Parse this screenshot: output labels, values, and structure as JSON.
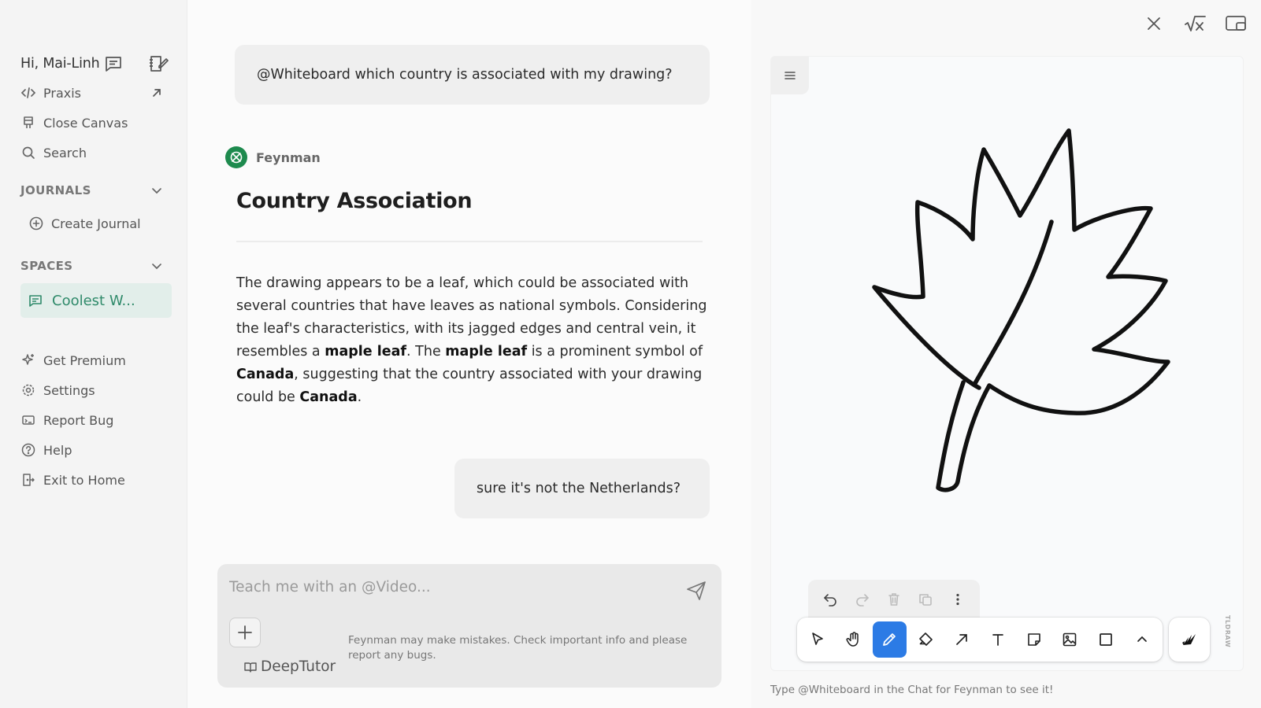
{
  "sidebar": {
    "greeting": "Hi, Mai-Linh",
    "top_items": [
      {
        "label": "Praxis",
        "icon": "code-icon"
      },
      {
        "label": "Close Canvas",
        "icon": "canvas-icon"
      },
      {
        "label": "Search",
        "icon": "search-icon"
      }
    ],
    "journals": {
      "heading": "JOURNALS",
      "create_label": "Create Journal"
    },
    "spaces": {
      "heading": "SPACES",
      "active_space": "Coolest W..."
    },
    "bottom_items": [
      {
        "label": "Get Premium",
        "icon": "sparkle-icon"
      },
      {
        "label": "Settings",
        "icon": "gear-icon"
      },
      {
        "label": "Report Bug",
        "icon": "bug-icon"
      },
      {
        "label": "Help",
        "icon": "help-icon"
      },
      {
        "label": "Exit to Home",
        "icon": "exit-icon"
      }
    ]
  },
  "chat": {
    "user_message_1": "@Whiteboard which country is associated with my drawing?",
    "assistant": {
      "name": "Feynman",
      "title": "Country Association",
      "body_parts": [
        "The drawing appears to be a leaf, which could be associated with several countries that have leaves as national symbols. Considering the leaf's characteristics, with its jagged edges and central vein, it resembles a ",
        "maple leaf",
        ". The ",
        "maple leaf",
        " is a prominent symbol of ",
        "Canada",
        ", suggesting that the country associated with your drawing could be ",
        "Canada",
        "."
      ]
    },
    "user_message_2": "sure it's not the Netherlands?",
    "composer": {
      "placeholder": "Teach me with an @Video...",
      "mode_label": "DeepTutor",
      "disclaimer": "Feynman may make mistakes. Check important info and please report any bugs."
    }
  },
  "whiteboard": {
    "hint": "Type @Whiteboard in the Chat for Feynman to see it!",
    "brand_mark": "TLDRAW",
    "active_tool": "draw",
    "accent_color": "#2c7be5"
  },
  "colors": {
    "space_active_bg": "#e2eeea",
    "space_active_text": "#2f8a6a",
    "avatar_green": "#1e8a4e"
  }
}
